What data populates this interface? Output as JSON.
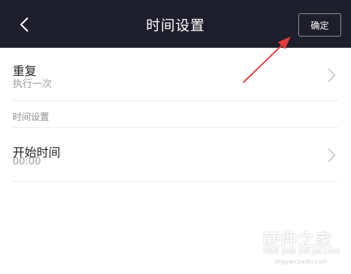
{
  "header": {
    "title": "时间设置",
    "confirm_label": "确定"
  },
  "repeat": {
    "label": "重复",
    "value": "执行一次"
  },
  "section": {
    "label": "时间设置"
  },
  "start_time": {
    "label": "开始时间",
    "value": "00:00"
  },
  "watermark": {
    "name": "硬件之家",
    "sub": "YING JIAN ZHI JIA.COM",
    "site": "jingyan.baidu.com"
  },
  "colors": {
    "header_bg": "#1e1e2c",
    "annotation_arrow": "#e53a3a"
  }
}
